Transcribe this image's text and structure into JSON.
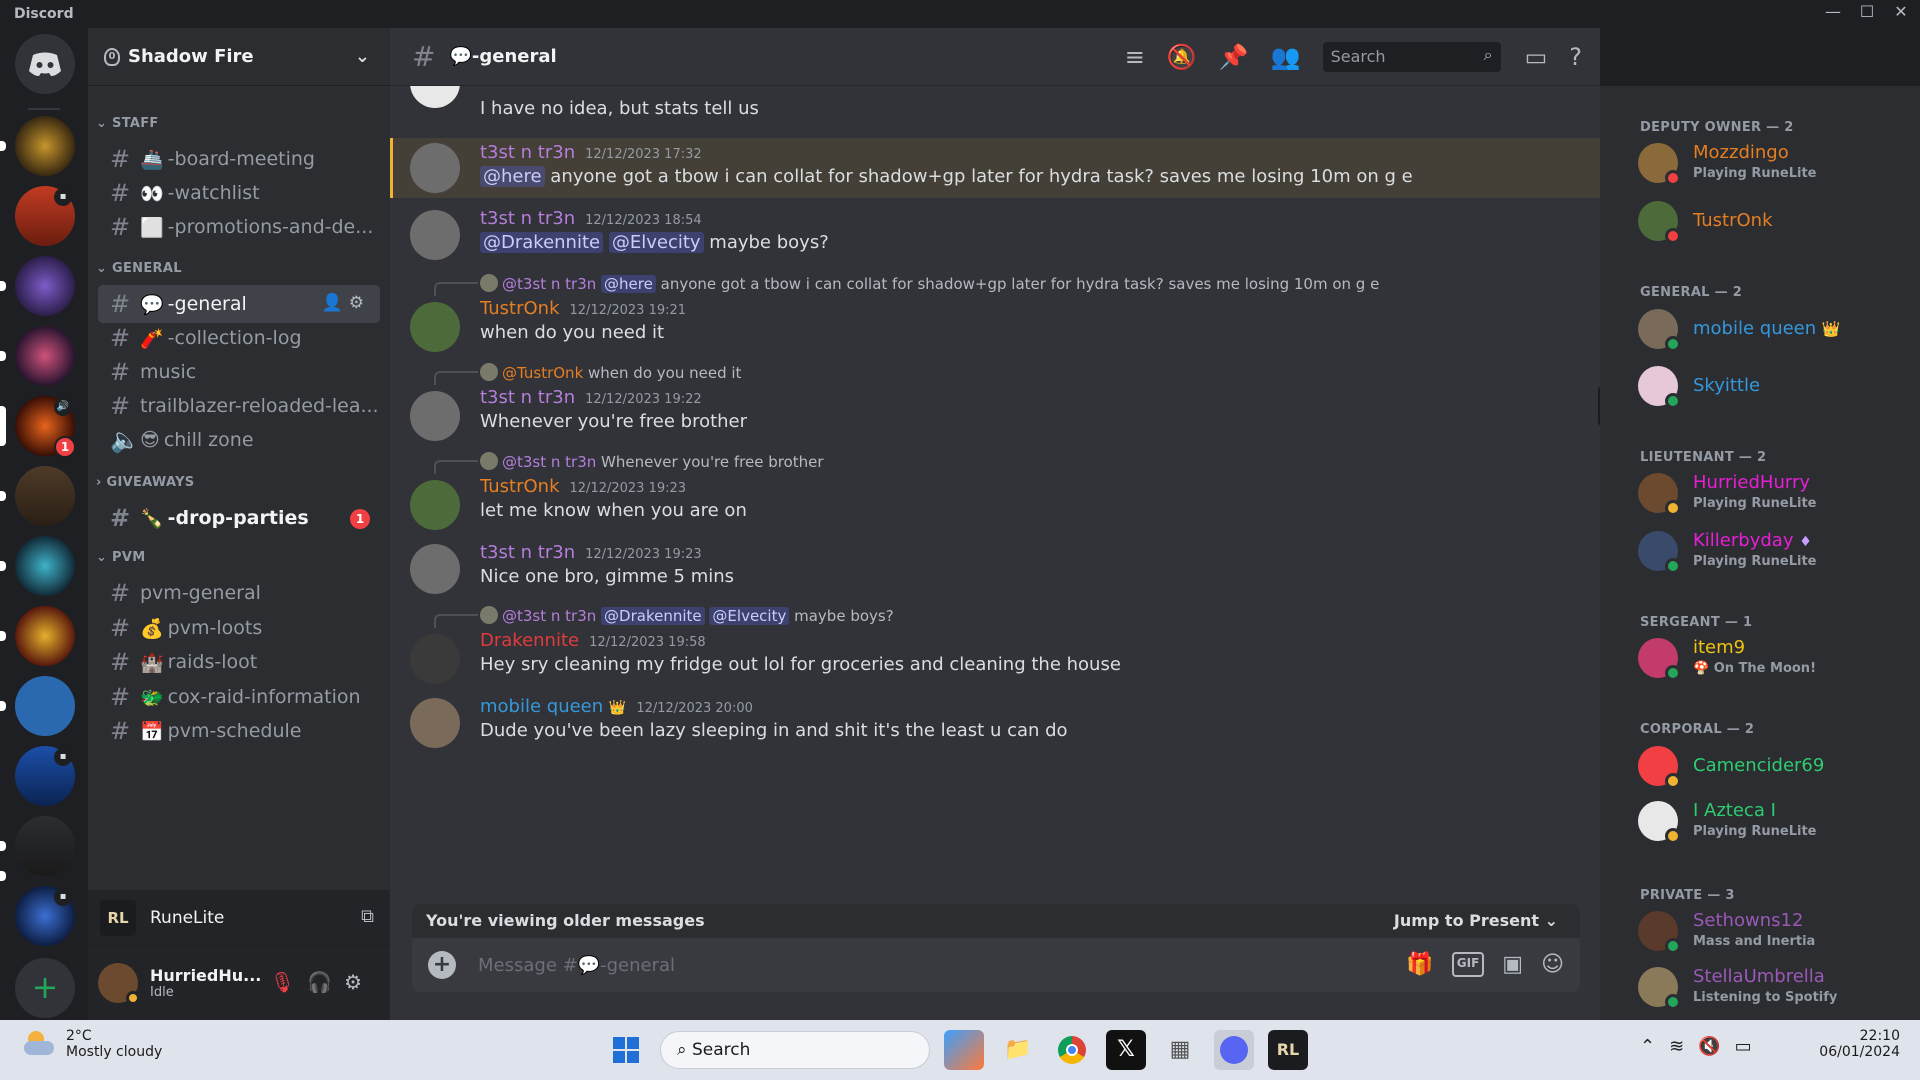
{
  "app": {
    "brand": "Discord",
    "window_controls": [
      "—",
      "☐",
      "✕"
    ]
  },
  "guilds": {
    "home_label": "Discord",
    "add_label": "+",
    "badges": [
      "1"
    ]
  },
  "server": {
    "name": "Shadow Fire",
    "boost_level": "0"
  },
  "categories": {
    "staff": "STAFF",
    "general": "GENERAL",
    "giveaways": "GIVEAWAYS",
    "pvm": "PVM"
  },
  "channels": [
    {
      "emoji": "🚢",
      "name": "-board-meeting"
    },
    {
      "emoji": "👀",
      "name": "-watchlist"
    },
    {
      "emoji": "⬜",
      "name": "-promotions-and-de..."
    },
    {
      "emoji": "💬",
      "name": "-general"
    },
    {
      "emoji": "🧨",
      "name": "-collection-log"
    },
    {
      "emoji": "",
      "name": "music"
    },
    {
      "emoji": "",
      "name": "trailblazer-reloaded-lea..."
    },
    {
      "emoji": "😎",
      "name": "chill zone"
    },
    {
      "emoji": "🍾",
      "name": "-drop-parties",
      "badge": "1"
    },
    {
      "emoji": "",
      "name": "pvm-general"
    },
    {
      "emoji": "💰",
      "name": "pvm-loots"
    },
    {
      "emoji": "🏰",
      "name": "raids-loot"
    },
    {
      "emoji": "🐲",
      "name": "cox-raid-information"
    },
    {
      "emoji": "📅",
      "name": "pvm-schedule"
    }
  ],
  "activity": {
    "name": "RuneLite",
    "logo": "RL"
  },
  "user": {
    "name": "HurriedHu...",
    "status": "Idle"
  },
  "chat": {
    "channel_title": "💬-general",
    "search_placeholder": "Search",
    "messages": [
      {
        "text": "I have no idea, but stats tell us"
      },
      {
        "author": "t3st n tr3n",
        "ts": "12/12/2023 17:32",
        "mention": "@here",
        "text": " anyone got a tbow i can collat for shadow+gp later for hydra task? saves me losing 10m on g e"
      },
      {
        "author": "t3st n tr3n",
        "ts": "12/12/2023 18:54",
        "mention1": "@Drakennite",
        "mention2": "@Elvecity",
        "text": " maybe boys?"
      },
      {
        "reply_author": "@t3st n tr3n",
        "reply_mention": "@here",
        "reply_text": " anyone got a tbow i can collat for shadow+gp later for hydra task? saves me losing 10m on g e",
        "author": "TustrOnk",
        "ts": "12/12/2023 19:21",
        "text": "when do you need it"
      },
      {
        "reply_author": "@TustrOnk",
        "reply_text": " when do you need it",
        "author": "t3st n tr3n",
        "ts": "12/12/2023 19:22",
        "text": "Whenever you're free brother"
      },
      {
        "reply_author": "@t3st n tr3n",
        "reply_text": " Whenever you're free brother",
        "author": "TustrOnk",
        "ts": "12/12/2023 19:23",
        "text": "let me know when you are on"
      },
      {
        "author": "t3st n tr3n",
        "ts": "12/12/2023 19:23",
        "text": "Nice one bro, gimme 5 mins"
      },
      {
        "reply_author": "@t3st n tr3n",
        "reply_mention1": "@Drakennite",
        "reply_mention2": "@Elvecity",
        "reply_text": " maybe boys?",
        "author": "Drakennite",
        "ts": "12/12/2023 19:58",
        "text": "Hey sry cleaning my fridge out lol for groceries and cleaning the house"
      },
      {
        "author": "mobile queen",
        "crown": "👑",
        "ts": "12/12/2023 20:00",
        "text": "Dude you've been lazy sleeping in and shit it's the least u can do"
      }
    ],
    "older_notice": "You're viewing older messages",
    "jump_label": "Jump to Present",
    "composer_placeholder": "Message #💬-general"
  },
  "members": {
    "roles": [
      "DEPUTY OWNER — 2",
      "GENERAL — 2",
      "LIEUTENANT — 2",
      "SERGEANT — 1",
      "CORPORAL — 2",
      "PRIVATE — 3"
    ],
    "list": [
      {
        "name": "Mozzdingo",
        "activity": "Playing RuneLite",
        "color": "#e67e22",
        "status": "#f23f43"
      },
      {
        "name": "TustrOnk",
        "activity": "",
        "color": "#e67e22",
        "status": "#f23f43"
      },
      {
        "name": "mobile queen",
        "activity": "",
        "color": "#3498db",
        "status": "#23a55a",
        "crown": "👑"
      },
      {
        "name": "Skyittle",
        "activity": "",
        "color": "#3498db",
        "status": "#23a55a"
      },
      {
        "name": "HurriedHurry",
        "activity": "Playing RuneLite",
        "color": "#e91ed7",
        "status": "#f0b232"
      },
      {
        "name": "Killerbyday",
        "activity": "Playing RuneLite",
        "color": "#e91ed7",
        "status": "#23a55a",
        "gem": "♦"
      },
      {
        "name": "item9",
        "activity": "🍄 On The Moon!",
        "color": "#f1c40f",
        "status": "#23a55a"
      },
      {
        "name": "Camencider69",
        "activity": "",
        "color": "#2ecc71",
        "status": "#f0b232"
      },
      {
        "name": "I Azteca I",
        "activity": "Playing RuneLite",
        "color": "#2ecc71",
        "status": "#f0b232"
      },
      {
        "name": "Sethowns12",
        "activity": "Mass and Inertia",
        "color": "#9b59b6",
        "status": "#23a55a"
      },
      {
        "name": "StellaUmbrella",
        "activity": "Listening to Spotify",
        "color": "#9b59b6",
        "status": "#23a55a"
      }
    ]
  },
  "taskbar": {
    "temp": "2°C",
    "weather": "Mostly cloudy",
    "search": "Search",
    "time": "22:10",
    "date": "06/01/2024"
  }
}
